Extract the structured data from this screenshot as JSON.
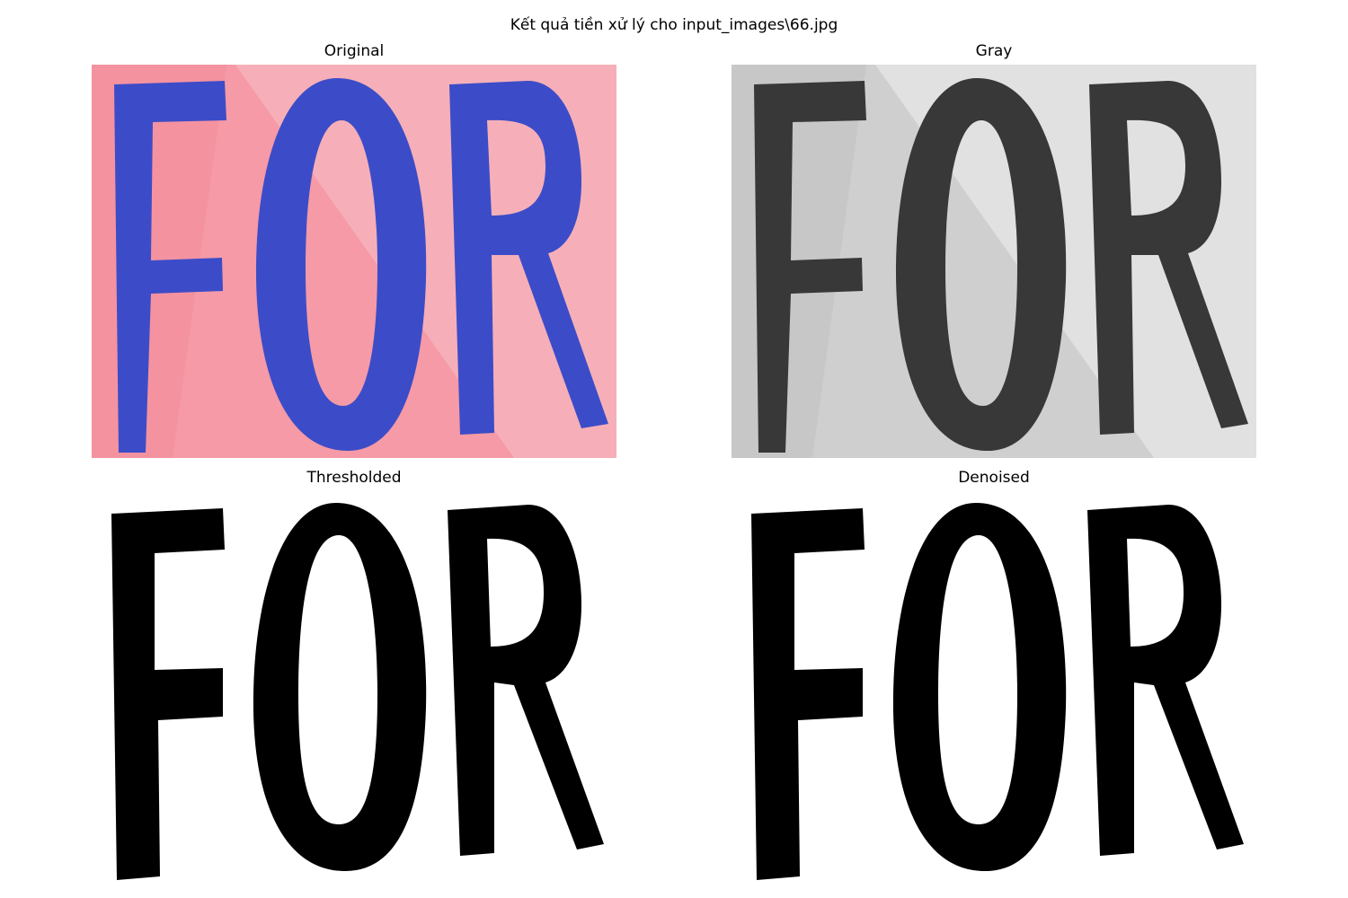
{
  "figure": {
    "title": "Kết quả tiền xử lý cho input_images\\66.jpg"
  },
  "panels": [
    {
      "title": "Original",
      "word": "FOR",
      "background": "#f59aa6",
      "ink": "#3c4cc8",
      "style": "color-photo"
    },
    {
      "title": "Gray",
      "word": "FOR",
      "background": "#d0d0d0",
      "ink": "#383838",
      "style": "grayscale-photo"
    },
    {
      "title": "Thresholded",
      "word": "FOR",
      "background": "#ffffff",
      "ink": "#000000",
      "style": "binary"
    },
    {
      "title": "Denoised",
      "word": "FOR",
      "background": "#ffffff",
      "ink": "#000000",
      "style": "binary"
    }
  ]
}
